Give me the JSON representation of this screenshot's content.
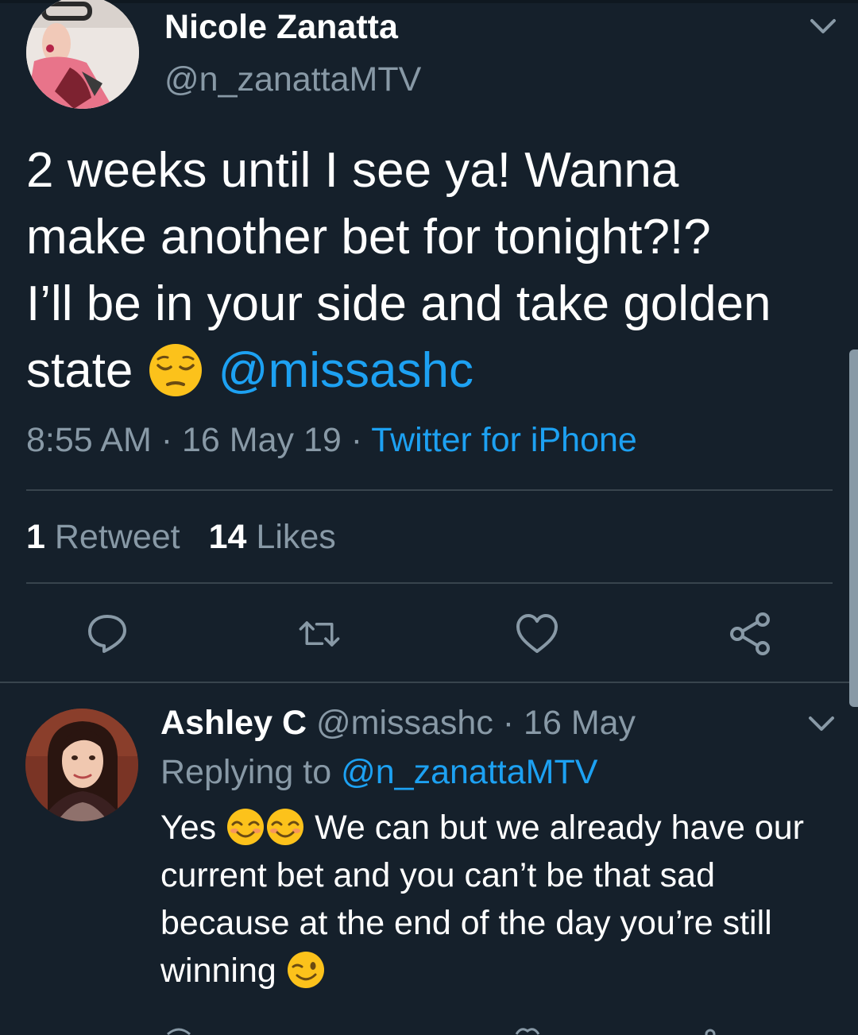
{
  "tweet": {
    "author_name": "Nicole Zanatta",
    "author_handle": "@n_zanattaMTV",
    "text_lines": [
      "2 weeks until I see ya! Wanna",
      "make another bet for tonight?!?",
      "I’ll be in your side and take golden",
      "state "
    ],
    "emoji": "pensive-face",
    "mention": "@missashc",
    "time": "8:55 AM",
    "date": "16 May 19",
    "separator": " · ",
    "source": "Twitter for iPhone",
    "retweets_count": "1",
    "retweets_label": "Retweet",
    "likes_count": "14",
    "likes_label": "Likes"
  },
  "actions": [
    "reply-icon",
    "retweet-icon",
    "like-icon",
    "share-icon"
  ],
  "reply": {
    "author_name": "Ashley C",
    "author_handle": "@missashc",
    "date": "16 May",
    "replying_label": "Replying to",
    "replying_handle": "@n_zanattaMTV",
    "text_first": "Yes",
    "text_after_emojis": "We can but we already have our",
    "text_lines": [
      "current bet and you can’t be that sad",
      "because at the end of the day you’re still"
    ],
    "text_last": "winning",
    "emojis": [
      "smiling-face-with-closed-eyes",
      "smiling-face-with-closed-eyes",
      "winking-face"
    ]
  },
  "colors": {
    "background": "#15202b",
    "primary_text": "#ffffff",
    "secondary_text": "#8899a6",
    "accent": "#1da1f2",
    "divider": "#38444d"
  }
}
